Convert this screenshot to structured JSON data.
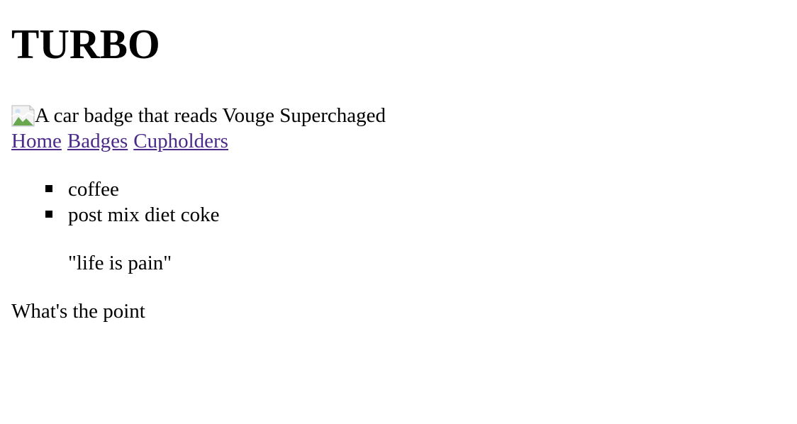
{
  "title": "TURBO",
  "badge_image": {
    "alt_text": "A car badge that reads Vouge Superchaged",
    "icon": "broken-image-icon"
  },
  "nav": {
    "items": [
      {
        "label": "Home"
      },
      {
        "label": "Badges"
      },
      {
        "label": "Cupholders"
      }
    ],
    "link_color": "#4b2a8a"
  },
  "cupholder_list": [
    {
      "label": "coffee"
    },
    {
      "label": "post mix diet coke"
    }
  ],
  "quote": "\"life is pain\"",
  "closing": "What's the point"
}
